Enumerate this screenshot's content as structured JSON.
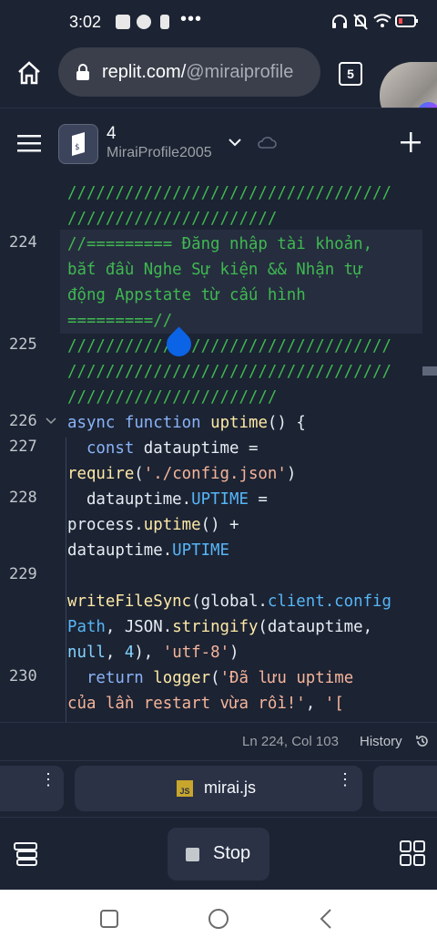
{
  "status_bar": {
    "time": "3:02"
  },
  "browser": {
    "url_host": "replit.com/",
    "url_path": "@miraiprofile",
    "tab_count": "5"
  },
  "header": {
    "repl_name": "4",
    "owner": "MiraiProfile2005"
  },
  "editor": {
    "line_numbers": [
      "224",
      "225",
      "226",
      "227",
      "228",
      "229",
      "230"
    ],
    "lines": {
      "pre1": "//////////////////////////////////",
      "pre2": "//////////////////////",
      "l224a": "//========= Đăng nhập tài khoản,",
      "l224b": "bắt đầu Nghe Sự kiện && Nhận tự",
      "l224c": "động Appstate từ cấu hình",
      "l224d": "=========//",
      "l225a": "//////////////////////////////////",
      "l225b": "//////////////////////////////////",
      "l225c": "//////////////////////",
      "l226_kw1": "async",
      "l226_kw2": "function",
      "l226_fn": "uptime",
      "l226_rest": "() {",
      "l227_kw": "const",
      "l227_var": "datauptime =",
      "l227b_fn": "require",
      "l227b_str": "'./config.json'",
      "l228_var": "datauptime.",
      "l228_prop": "UPTIME",
      "l228_eq": " =",
      "l228b_obj": "process.",
      "l228b_fn": "uptime",
      "l228b_rest": "() +",
      "l228c_var": "datauptime.",
      "l228c_prop": "UPTIME",
      "l229a_fn": "writeFileSync",
      "l229a_rest": "(global.",
      "l229a_prop": "client.config",
      "l229b_prop": "Path",
      "l229b_rest": ", JSON.",
      "l229b_fn": "stringify",
      "l229b_rest2": "(datauptime,",
      "l229c_null": "null",
      "l229c_num": "4",
      "l229c_str": "'utf-8'",
      "l230_kw": "return",
      "l230_fn": "logger",
      "l230_str": "'Đã lưu uptime",
      "l230b_str": "của lần restart vừa rồi!'",
      "l230b_str2": "'["
    }
  },
  "status_line": {
    "cursor": "Ln 224, Col 103",
    "history_label": "History"
  },
  "tabs": {
    "active_file": "mirai.js",
    "file_badge": "JS"
  },
  "toolbar": {
    "stop_label": "Stop"
  },
  "colors": {
    "bg": "#1c2333",
    "comment": "#3fb950",
    "keyword": "#8ab4f8",
    "accent_drop": "#0b63e5"
  }
}
